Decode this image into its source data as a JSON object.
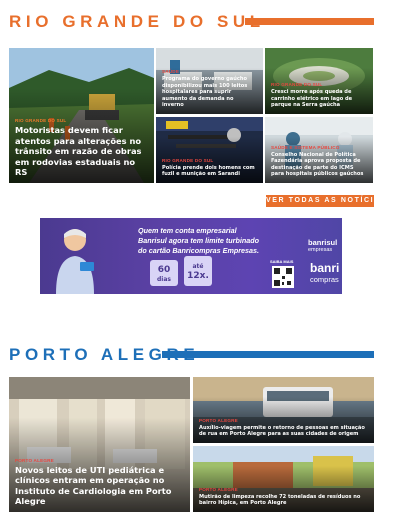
{
  "rs_section": {
    "title": "RIO GRANDE DO SUL",
    "accent": "#e86f2c",
    "cards": [
      {
        "kicker": "RIO GRANDE DO SUL",
        "headline": "Motoristas devem ficar atentos para alterações no trânsito em razão de obras em rodovias estaduais no RS"
      },
      {
        "kicker": "SAÚDE",
        "headline": "Programa do governo gaúcho disponibilizou mais 100 leitos hospitalares para suprir aumento da demanda no inverno"
      },
      {
        "kicker": "RIO GRANDE DO SUL",
        "headline": "Cresci morre após queda de carrinho elétrico em lago de parque na Serra gaúcha"
      },
      {
        "kicker": "RIO GRANDE DO SUL",
        "headline": "Polícia prende dois homens com fuzil e munição em Sarandi"
      },
      {
        "kicker": "SAÚDE E SISTEMA PÚBLICO",
        "headline": "Conselho Nacional de Política Fazendária aprova proposta de destinação de parte do ICMS para hospitais públicos gaúchos"
      }
    ],
    "more_label": "VER TODAS AS NOTÍCIAS"
  },
  "banner": {
    "line1": "Quem tem conta empresarial",
    "line2": "Banrisul agora tem limite turbinado",
    "line3": "do cartão Banricompras Empresas.",
    "bag1_top": "60",
    "bag1_bottom": "dias",
    "bag2_top": "até",
    "bag2_bottom": "12x.",
    "qr_label": "SAIBA MAIS",
    "logo_banrisul": "banrisul",
    "logo_empresas": "empresas",
    "logo_banri": "banri",
    "logo_compras": "compras"
  },
  "poa_section": {
    "title": "PORTO ALEGRE",
    "accent": "#1d6fb8",
    "cards": [
      {
        "kicker": "PORTO ALEGRE",
        "headline": "Novos leitos de UTI pediátrica e clínicos entram em operação no Instituto de Cardiologia em Porto Alegre"
      },
      {
        "kicker": "PORTO ALEGRE",
        "headline": "Auxílio-viagem permite o retorno de pessoas em situação de rua em Porto Alegre para as suas cidades de origem"
      },
      {
        "kicker": "PORTO ALEGRE",
        "headline": "Mutirão de limpeza recolhe 72 toneladas de resíduos no bairro Hípica, em Porto Alegre"
      }
    ]
  }
}
